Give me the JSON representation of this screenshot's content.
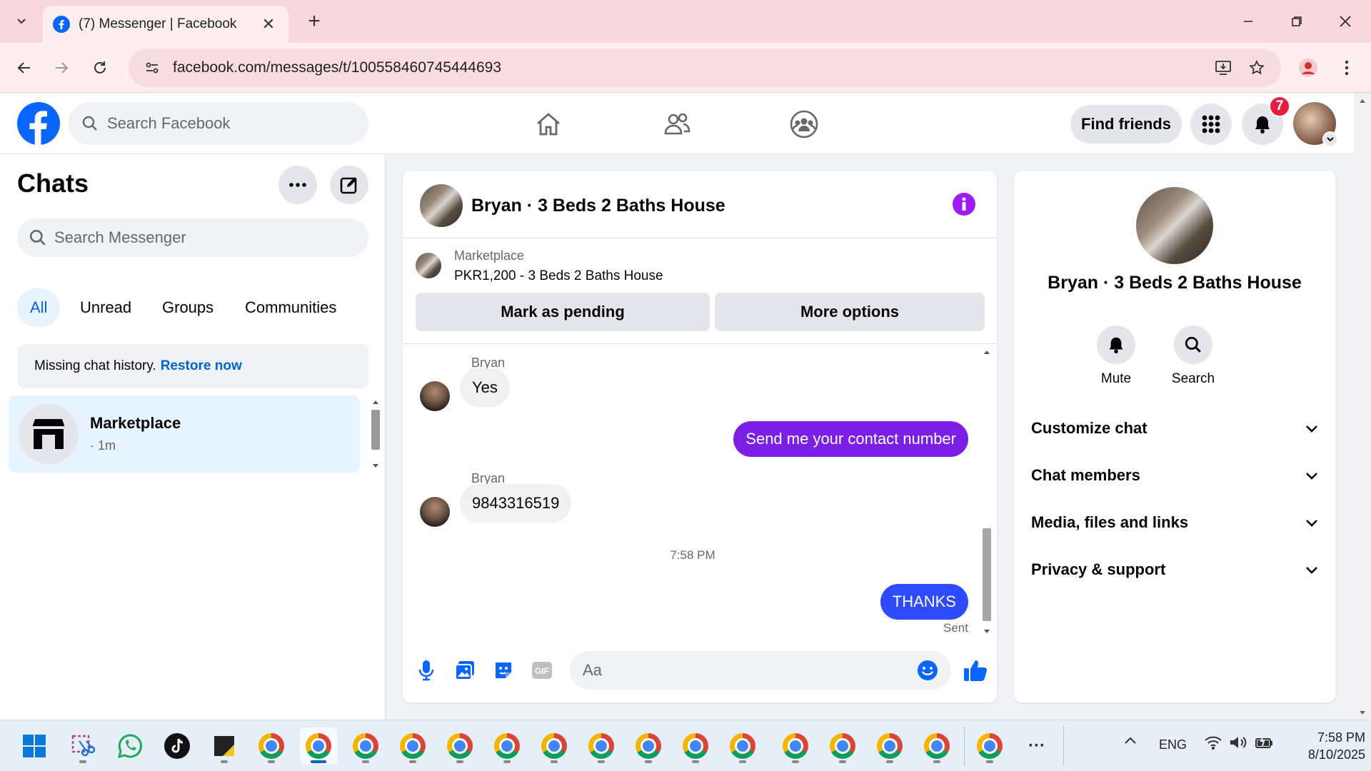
{
  "browser": {
    "tab_title": "(7) Messenger | Facebook",
    "url": "facebook.com/messages/t/100558460745444693",
    "tab_close_glyph": "✕",
    "new_tab_glyph": "+"
  },
  "header": {
    "search_placeholder": "Search Facebook",
    "find_friends_label": "Find friends",
    "notification_count": "7",
    "nav_icons": [
      "home-icon",
      "friends-icon",
      "groups-icon"
    ]
  },
  "chats": {
    "title": "Chats",
    "search_placeholder": "Search Messenger",
    "filters": [
      "All",
      "Unread",
      "Groups",
      "Communities"
    ],
    "active_filter": "All",
    "missing_history_text": "Missing chat history.",
    "restore_link": "Restore now",
    "items": [
      {
        "name": "Marketplace",
        "time": "· 1m",
        "selected": true
      }
    ]
  },
  "conversation": {
    "title": "Bryan · 3 Beds 2 Baths House",
    "marketplace": {
      "label": "Marketplace",
      "listing": "PKR1,200 - 3 Beds 2 Baths House",
      "mark_pending": "Mark as pending",
      "more_options": "More options"
    },
    "messages": [
      {
        "sender": "Bryan",
        "text": "Yes",
        "direction": "in"
      },
      {
        "text": "Send me your contact number",
        "direction": "out"
      },
      {
        "sender": "Bryan",
        "text": "9843316519",
        "direction": "in"
      },
      {
        "text": "THANKS",
        "direction": "out"
      }
    ],
    "time_divider": "7:58 PM",
    "status": "Sent",
    "composer_placeholder": "Aa"
  },
  "details": {
    "name": "Bryan · 3 Beds 2 Baths House",
    "actions": [
      {
        "label": "Mute",
        "icon": "bell-icon"
      },
      {
        "label": "Search",
        "icon": "search-icon"
      }
    ],
    "sections": [
      "Customize chat",
      "Chat members",
      "Media, files and links",
      "Privacy & support"
    ]
  },
  "taskbar": {
    "language": "ENG",
    "time": "7:58 PM",
    "date": "8/10/2025",
    "more_glyph": "···"
  },
  "colors": {
    "fb_blue": "#0866ff",
    "bubble_out_1": "#7b1fe6",
    "bubble_out_2": "#2f4bff",
    "info_purple": "#9b1cf5",
    "tab_bar": "#f8d7dc"
  }
}
